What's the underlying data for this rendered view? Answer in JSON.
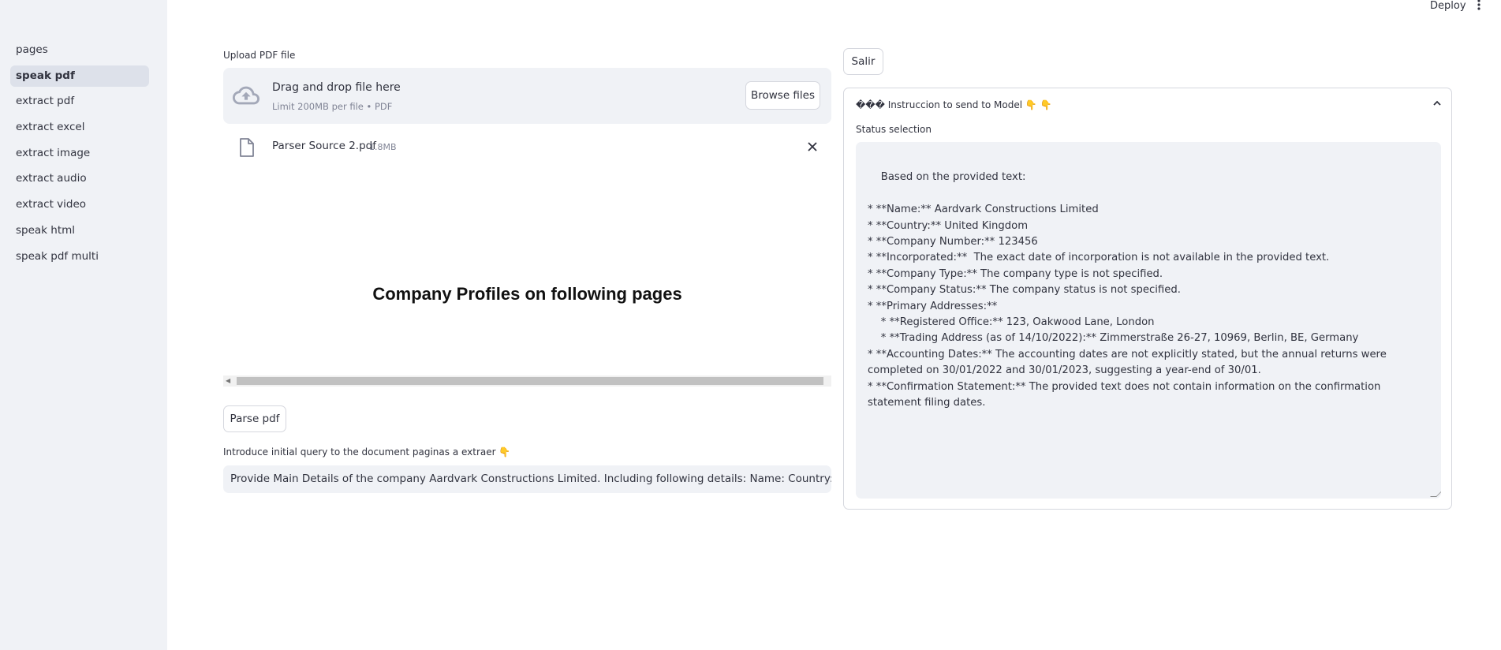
{
  "topbar": {
    "deploy_label": "Deploy",
    "menu_icon": "more-vert-icon"
  },
  "sidebar": {
    "items": [
      {
        "label": "pages",
        "active": false
      },
      {
        "label": "speak pdf",
        "active": true
      },
      {
        "label": "extract pdf",
        "active": false
      },
      {
        "label": "extract excel",
        "active": false
      },
      {
        "label": "extract image",
        "active": false
      },
      {
        "label": "extract audio",
        "active": false
      },
      {
        "label": "extract video",
        "active": false
      },
      {
        "label": "speak html",
        "active": false
      },
      {
        "label": "speak pdf multi",
        "active": false
      }
    ]
  },
  "uploader": {
    "label": "Upload PDF file",
    "drop_title": "Drag and drop file here",
    "drop_sub": "Limit 200MB per file • PDF",
    "browse_label": "Browse files",
    "file_name": "Parser Source 2.pdf",
    "file_size": "1.8MB"
  },
  "pdf_preview": {
    "heading": "Company Profiles on following pages"
  },
  "parse_button": "Parse pdf",
  "query": {
    "label": "Introduce initial query to the document paginas a extraer 👇",
    "value": "Provide Main Details of the company Aardvark Constructions Limited. Including following details: Name: Country: Company Nu"
  },
  "right_panel": {
    "salir_label": "Salir",
    "expander_title": "��� Instruccion to send to Model 👇 👇",
    "status_label": "Status selection",
    "response_text": "Based on the provided text:\n\n* **Name:** Aardvark Constructions Limited\n* **Country:** United Kingdom\n* **Company Number:** 123456\n* **Incorporated:**  The exact date of incorporation is not available in the provided text.\n* **Company Type:** The company type is not specified.\n* **Company Status:** The company status is not specified.\n* **Primary Addresses:**\n    * **Registered Office:** 123, Oakwood Lane, London\n    * **Trading Address (as of 14/10/2022):** Zimmerstraße 26-27, 10969, Berlin, BE, Germany\n* **Accounting Dates:** The accounting dates are not explicitly stated, but the annual returns were completed on 30/01/2022 and 30/01/2023, suggesting a year-end of 30/01.\n* **Confirmation Statement:** The provided text does not contain information on the confirmation statement filing dates."
  }
}
